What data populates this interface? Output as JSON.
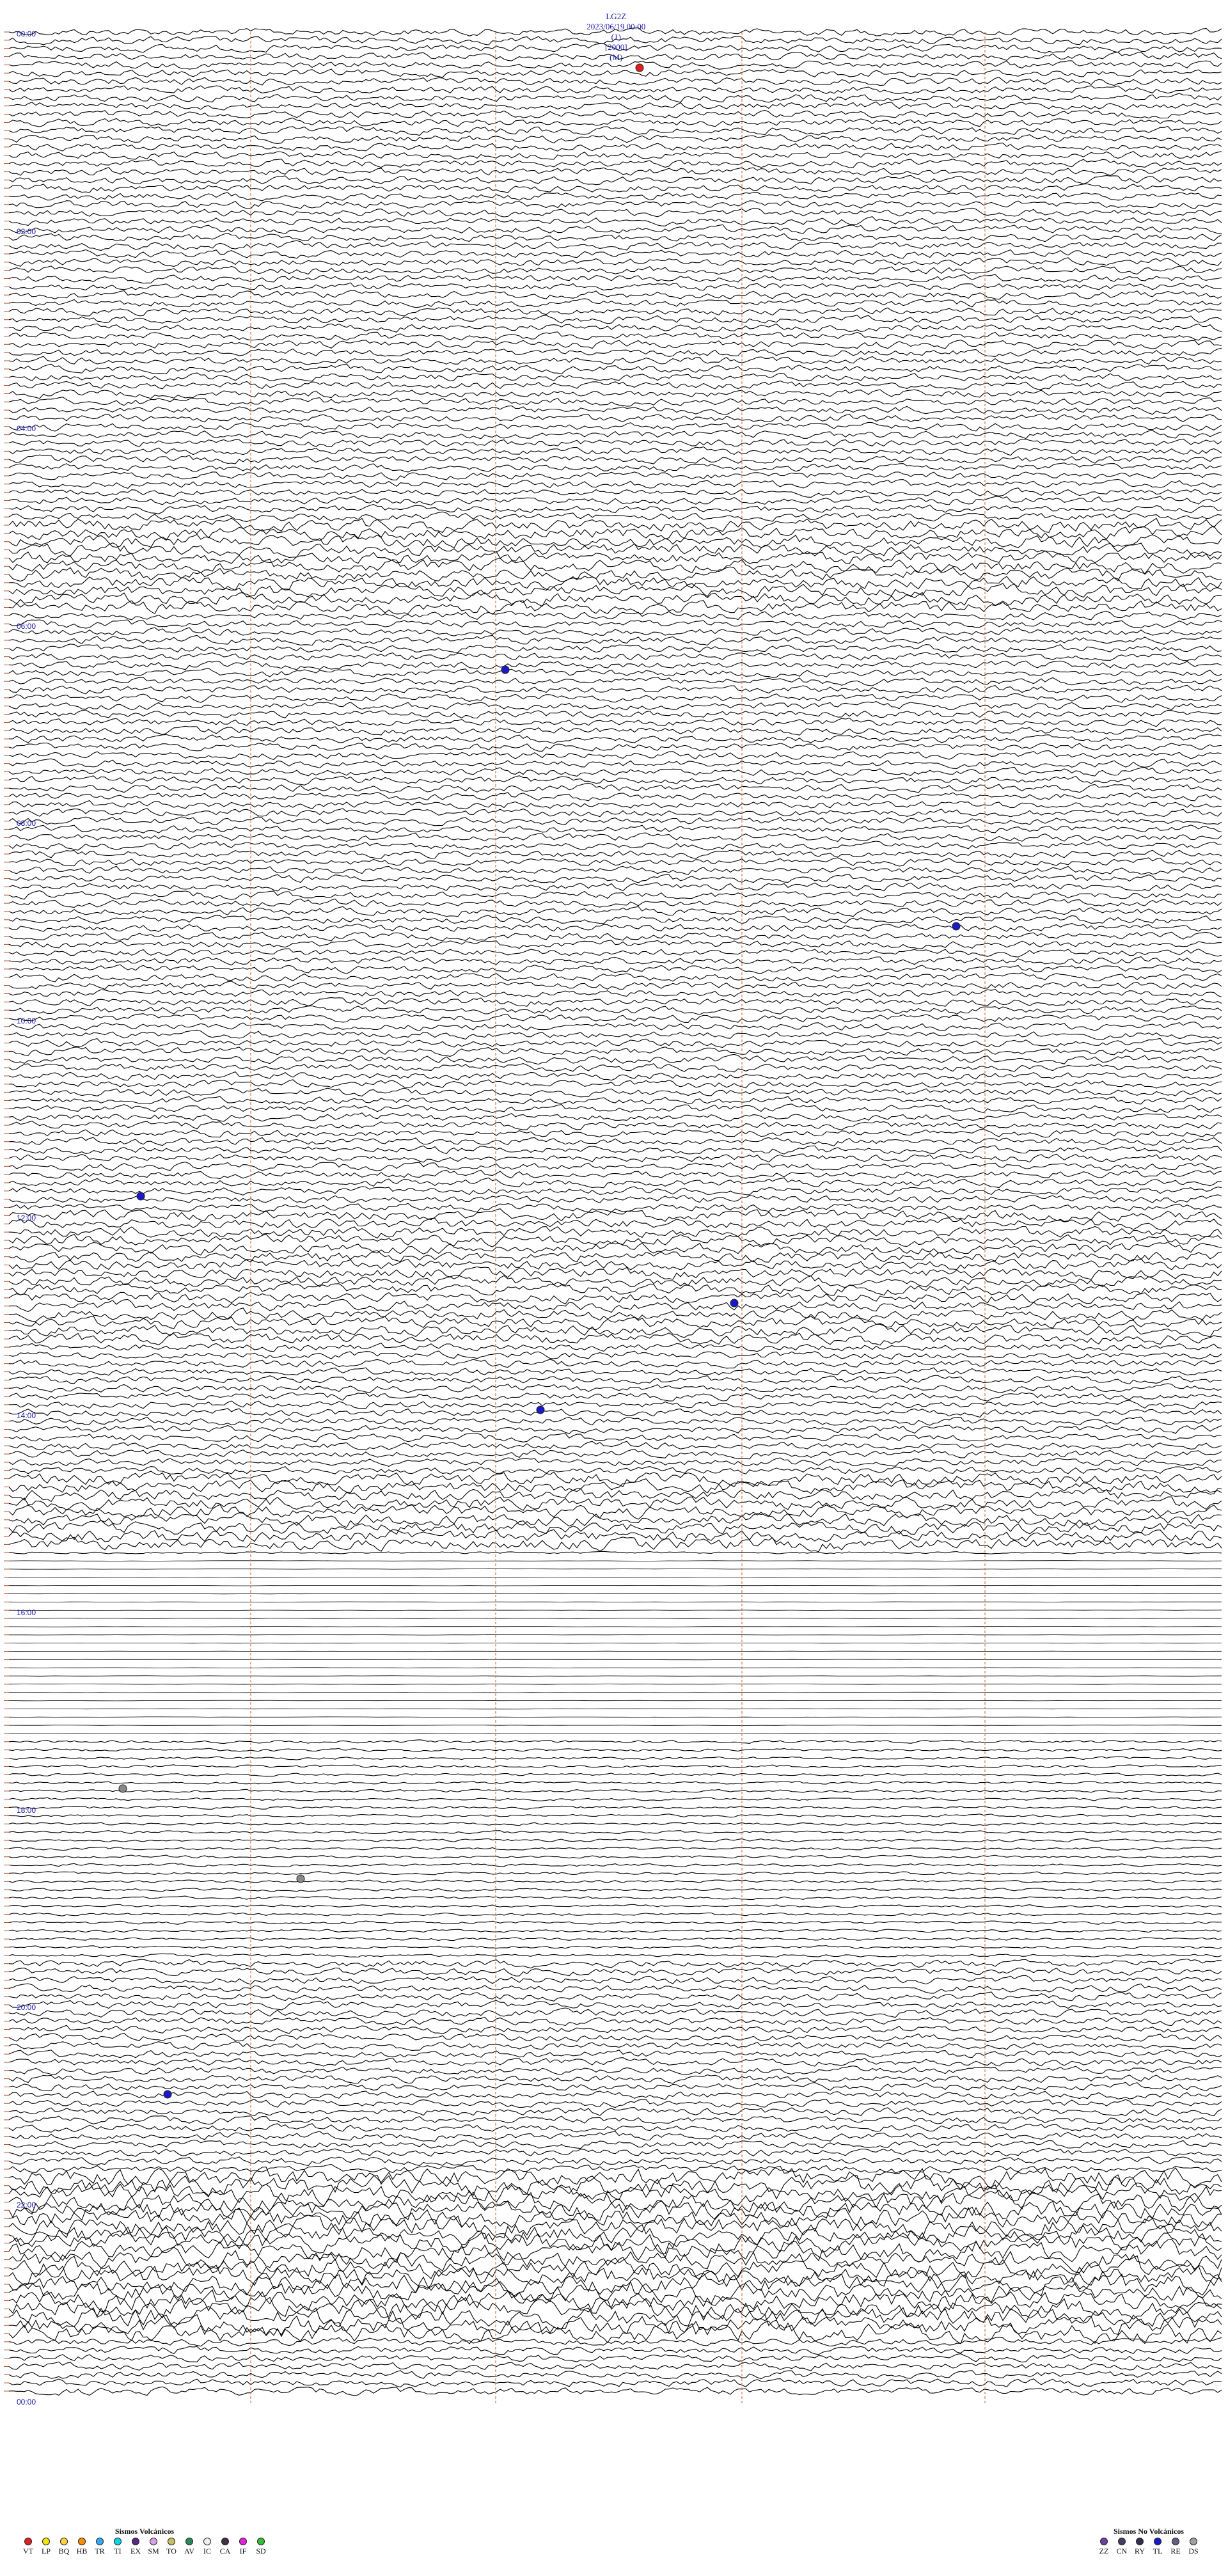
{
  "header": {
    "station": "LG2Z",
    "datetime": "2023/06/19 00:00",
    "channel": "(1)",
    "scale": "[2000]",
    "mode": "(M)"
  },
  "hour_labels": [
    "00:00",
    "02:00",
    "04:00",
    "06:00",
    "08:00",
    "10:00",
    "12:00",
    "14:00",
    "16:00",
    "18:00",
    "20:00",
    "22:00",
    "00:00"
  ],
  "legend_volcanic": {
    "title": "Sismos Volcánicos",
    "items": [
      {
        "code": "VT",
        "color": "#e02020"
      },
      {
        "code": "LP",
        "color": "#f2e600"
      },
      {
        "code": "BQ",
        "color": "#ffd040"
      },
      {
        "code": "HB",
        "color": "#ff8c00"
      },
      {
        "code": "TR",
        "color": "#33aaff"
      },
      {
        "code": "TI",
        "color": "#00d8e0"
      },
      {
        "code": "EX",
        "color": "#5a2a80"
      },
      {
        "code": "SM",
        "color": "#d8a0e8"
      },
      {
        "code": "TO",
        "color": "#c8c060"
      },
      {
        "code": "AV",
        "color": "#2a8a5a"
      },
      {
        "code": "IC",
        "color": "#f0f0f0"
      },
      {
        "code": "CA",
        "color": "#403040"
      },
      {
        "code": "IF",
        "color": "#e020e0"
      },
      {
        "code": "SD",
        "color": "#30c030"
      }
    ]
  },
  "legend_nonvolcanic": {
    "title": "Sismos No Volcánicos",
    "items": [
      {
        "code": "ZZ",
        "color": "#7040a0"
      },
      {
        "code": "CN",
        "color": "#404060"
      },
      {
        "code": "RY",
        "color": "#303050"
      },
      {
        "code": "TL",
        "color": "#1a1acc"
      },
      {
        "code": "RE",
        "color": "#606080"
      },
      {
        "code": "DS",
        "color": "#a0a0a0"
      }
    ]
  }
}
